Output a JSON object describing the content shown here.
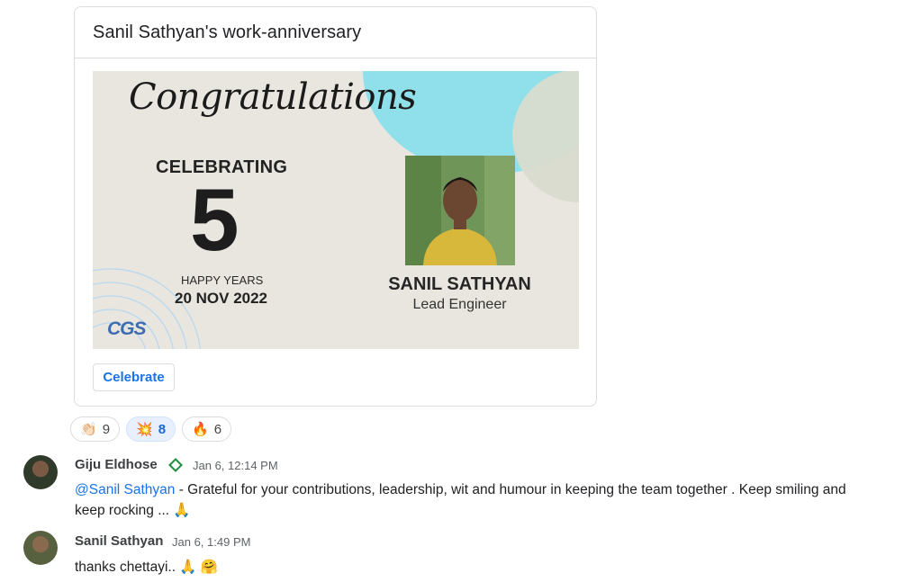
{
  "card": {
    "title": "Sanil Sathyan's work-anniversary",
    "banner": {
      "heading": "Congratulations",
      "celebrating": "CELEBRATING",
      "years": "5",
      "happy_years": "HAPPY YEARS",
      "date": "20 NOV 2022",
      "logo_text": "CGS",
      "employee_name": "SANIL SATHYAN",
      "employee_role": "Lead Engineer"
    },
    "celebrate_label": "Celebrate"
  },
  "reactions": [
    {
      "emoji": "👏🏻",
      "count": "9",
      "active": false
    },
    {
      "emoji": "💥",
      "count": "8",
      "active": true
    },
    {
      "emoji": "🔥",
      "count": "6",
      "active": false
    }
  ],
  "messages": [
    {
      "author": "Giju Eldhose",
      "time": "Jan 6, 12:14 PM",
      "mention": "@Sanil Sathyan",
      "text_line1": " - Grateful for your contributions, leadership, wit and humour in keeping the team together  . Keep smiling and",
      "text_line2": "keep rocking ... ",
      "emojis": "🙏"
    },
    {
      "author": "Sanil Sathyan",
      "time": "Jan 6, 1:49 PM",
      "text": "thanks chettayi.. ",
      "emojis": "🙏 🤗"
    }
  ],
  "colors": {
    "accent": "#1a73e8",
    "banner_bg": "#e8e6df",
    "blob": "#8fe0ea"
  }
}
